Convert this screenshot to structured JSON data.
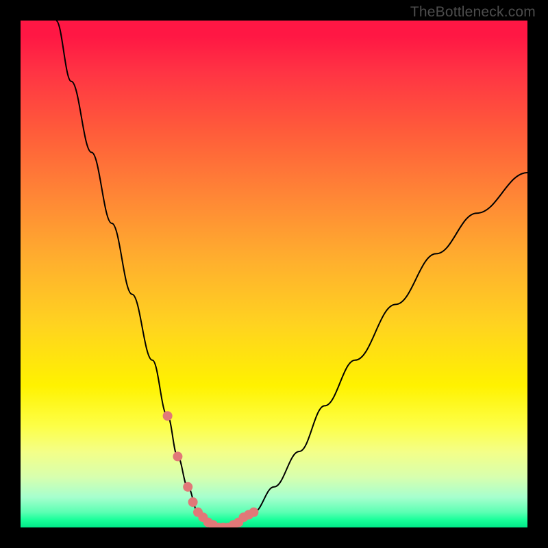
{
  "watermark": "TheBottleneck.com",
  "chart_data": {
    "type": "line",
    "title": "",
    "xlabel": "",
    "ylabel": "",
    "xlim": [
      0,
      100
    ],
    "ylim": [
      0,
      100
    ],
    "grid": false,
    "series": [
      {
        "name": "bottleneck-curve",
        "x": [
          7,
          10,
          14,
          18,
          22,
          26,
          29,
          31,
          33,
          35,
          37,
          39,
          41,
          43,
          46,
          50,
          55,
          60,
          66,
          74,
          82,
          90,
          100
        ],
        "values": [
          100,
          88,
          74,
          60,
          46,
          33,
          22,
          14,
          8,
          3,
          1,
          0,
          0,
          1,
          3,
          8,
          15,
          24,
          33,
          44,
          54,
          62,
          70
        ]
      }
    ],
    "highlight": {
      "name": "sweet-spot-dots",
      "color": "#e17878",
      "x": [
        29,
        31,
        33,
        34,
        35,
        36,
        37,
        38,
        39,
        40,
        41,
        42,
        43,
        44,
        45,
        46
      ],
      "values": [
        22,
        14,
        8,
        5,
        3,
        2,
        1,
        0.5,
        0,
        0,
        0,
        0.5,
        1,
        2,
        2.5,
        3
      ]
    },
    "background_gradient": {
      "top": "#ff1744",
      "mid": "#fff200",
      "bottom": "#00e888"
    }
  }
}
